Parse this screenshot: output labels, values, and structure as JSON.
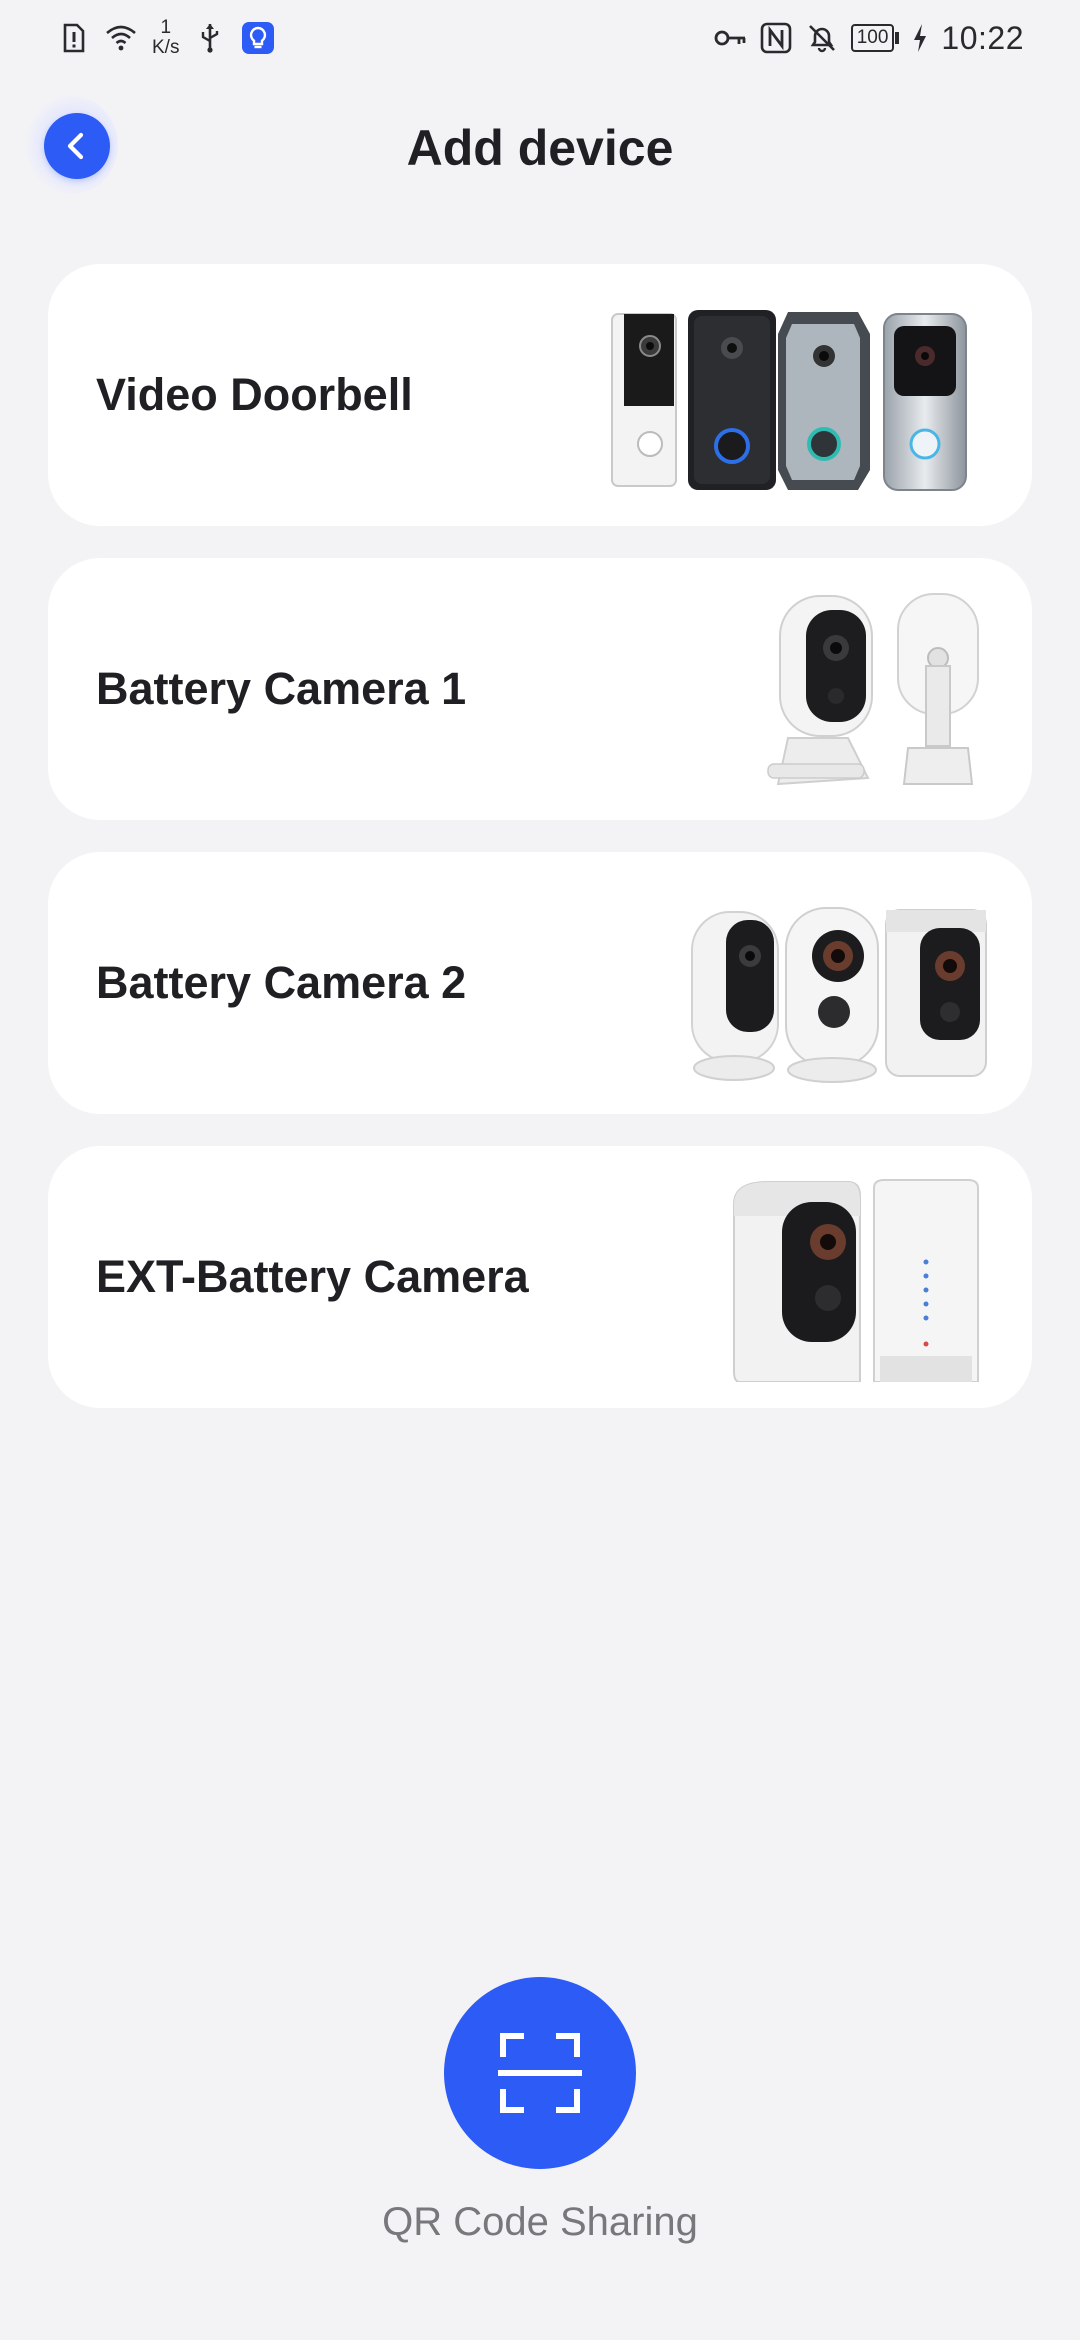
{
  "status_bar": {
    "net_speed_value": "1",
    "net_speed_unit": "K/s",
    "battery_level": "100",
    "time": "10:22",
    "icons": [
      "alert-sim-icon",
      "wifi-icon",
      "usb-icon",
      "bulb-app-icon",
      "key-icon",
      "nfc-icon",
      "bell-off-icon",
      "battery-icon",
      "charging-icon"
    ]
  },
  "header": {
    "title": "Add device",
    "back_icon": "chevron-left-icon"
  },
  "devices": [
    {
      "label": "Video Doorbell",
      "image": "video-doorbell-products"
    },
    {
      "label": "Battery Camera 1",
      "image": "battery-camera-1-products"
    },
    {
      "label": "Battery Camera 2",
      "image": "battery-camera-2-products"
    },
    {
      "label": "EXT-Battery Camera",
      "image": "ext-battery-camera-products"
    }
  ],
  "qr": {
    "label": "QR Code Sharing",
    "icon": "scan-frame-icon"
  },
  "colors": {
    "accent": "#2d5bf5",
    "background": "#f3f3f6",
    "card": "#ffffff",
    "title_text": "#1f1f24",
    "muted_text": "#77777c"
  }
}
